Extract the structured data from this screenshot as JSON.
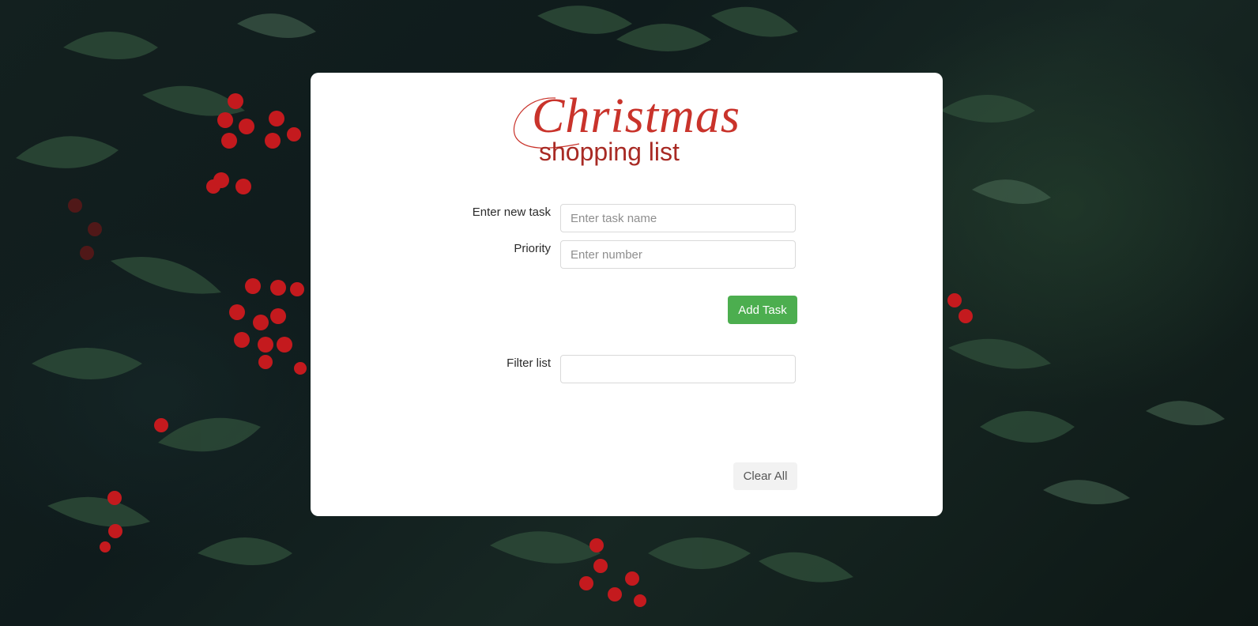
{
  "logo": {
    "title": "Christmas",
    "subtitle": "shopping list"
  },
  "form": {
    "task_label": "Enter new task",
    "task_placeholder": "Enter task name",
    "priority_label": "Priority",
    "priority_placeholder": "Enter number",
    "add_button": "Add Task"
  },
  "filter": {
    "label": "Filter list",
    "value": ""
  },
  "clear_button": "Clear All",
  "colors": {
    "title_red": "#c9332b",
    "add_green": "#4cae4f",
    "card_bg": "#ffffff"
  },
  "icons": [
    "holly-background-image"
  ]
}
